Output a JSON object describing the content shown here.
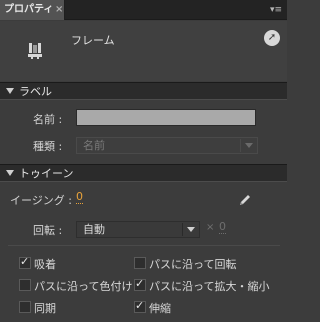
{
  "panel": {
    "tab_label": "プロパティ",
    "tab_close": "×",
    "menu_icon": "▾≡"
  },
  "top": {
    "symbol_name": "フレーム",
    "goto_icon": "➚"
  },
  "label_section": {
    "header": "ラベル",
    "name_label": "名前 :",
    "name_value": "",
    "type_label": "種類 :",
    "type_value": "名前"
  },
  "tween_section": {
    "header": "トゥイーン",
    "ease_label": "イージング :",
    "ease_value": "0",
    "rotate_label": "回転 :",
    "rotate_value": "自動",
    "times_symbol": "×",
    "rotate_count": "0"
  },
  "options": {
    "snap": {
      "label": "吸着",
      "checked": true
    },
    "orient_to_path": {
      "label": "パスに沿って回転",
      "checked": false
    },
    "color_along_path": {
      "label": "パスに沿って色付け",
      "checked": false
    },
    "scale_along_path": {
      "label": "パスに沿って拡大・縮小",
      "checked": true
    },
    "sync": {
      "label": "同期",
      "checked": false
    },
    "scale": {
      "label": "伸縮",
      "checked": true
    }
  }
}
